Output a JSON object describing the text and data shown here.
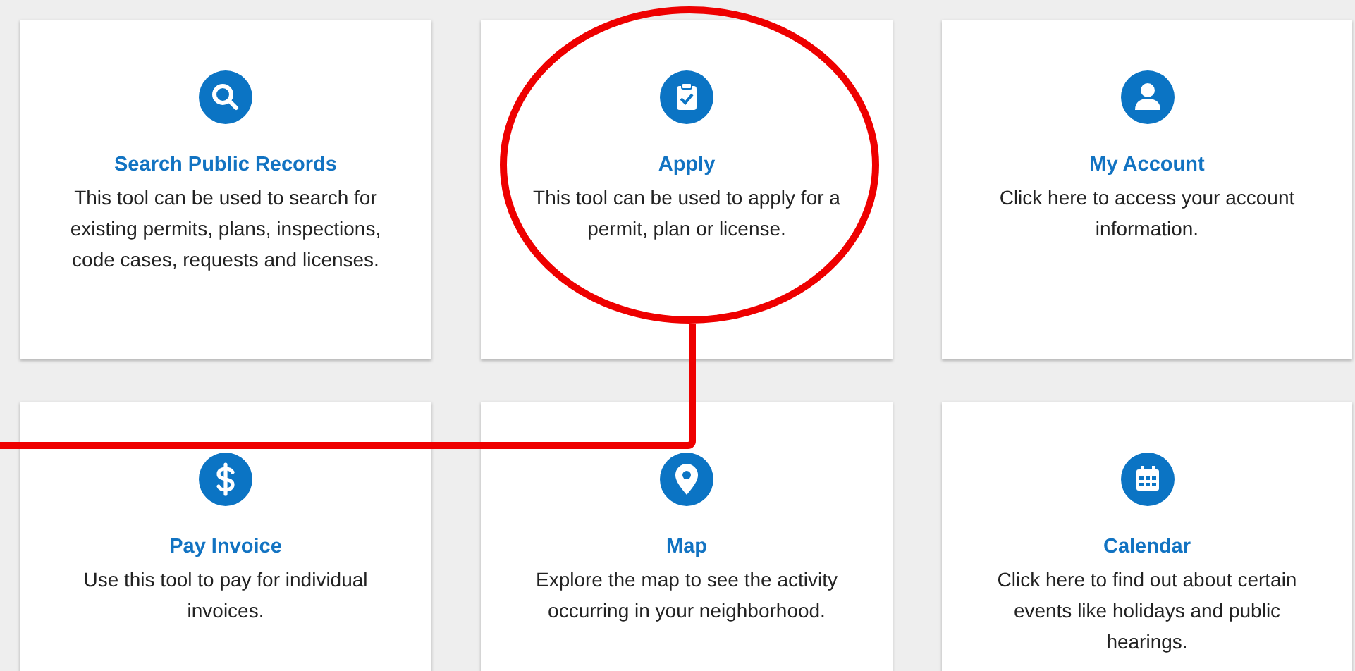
{
  "tiles": [
    {
      "kind": "search",
      "title": "Search Public Records",
      "description": "This tool can be used to search for existing permits, plans, inspections, code cases, requests and licenses."
    },
    {
      "kind": "clipboard",
      "title": "Apply",
      "description": "This tool can be used to apply for a permit, plan or license."
    },
    {
      "kind": "person",
      "title": "My Account",
      "description": "Click here to access your account information."
    },
    {
      "kind": "dollar",
      "title": "Pay Invoice",
      "description": "Use this tool to pay for individual invoices."
    },
    {
      "kind": "pin",
      "title": "Map",
      "description": "Explore the map to see the activity occurring in your neighborhood."
    },
    {
      "kind": "calendar",
      "title": "Calendar",
      "description": "Click here to find out about certain events like holidays and public hearings."
    }
  ]
}
